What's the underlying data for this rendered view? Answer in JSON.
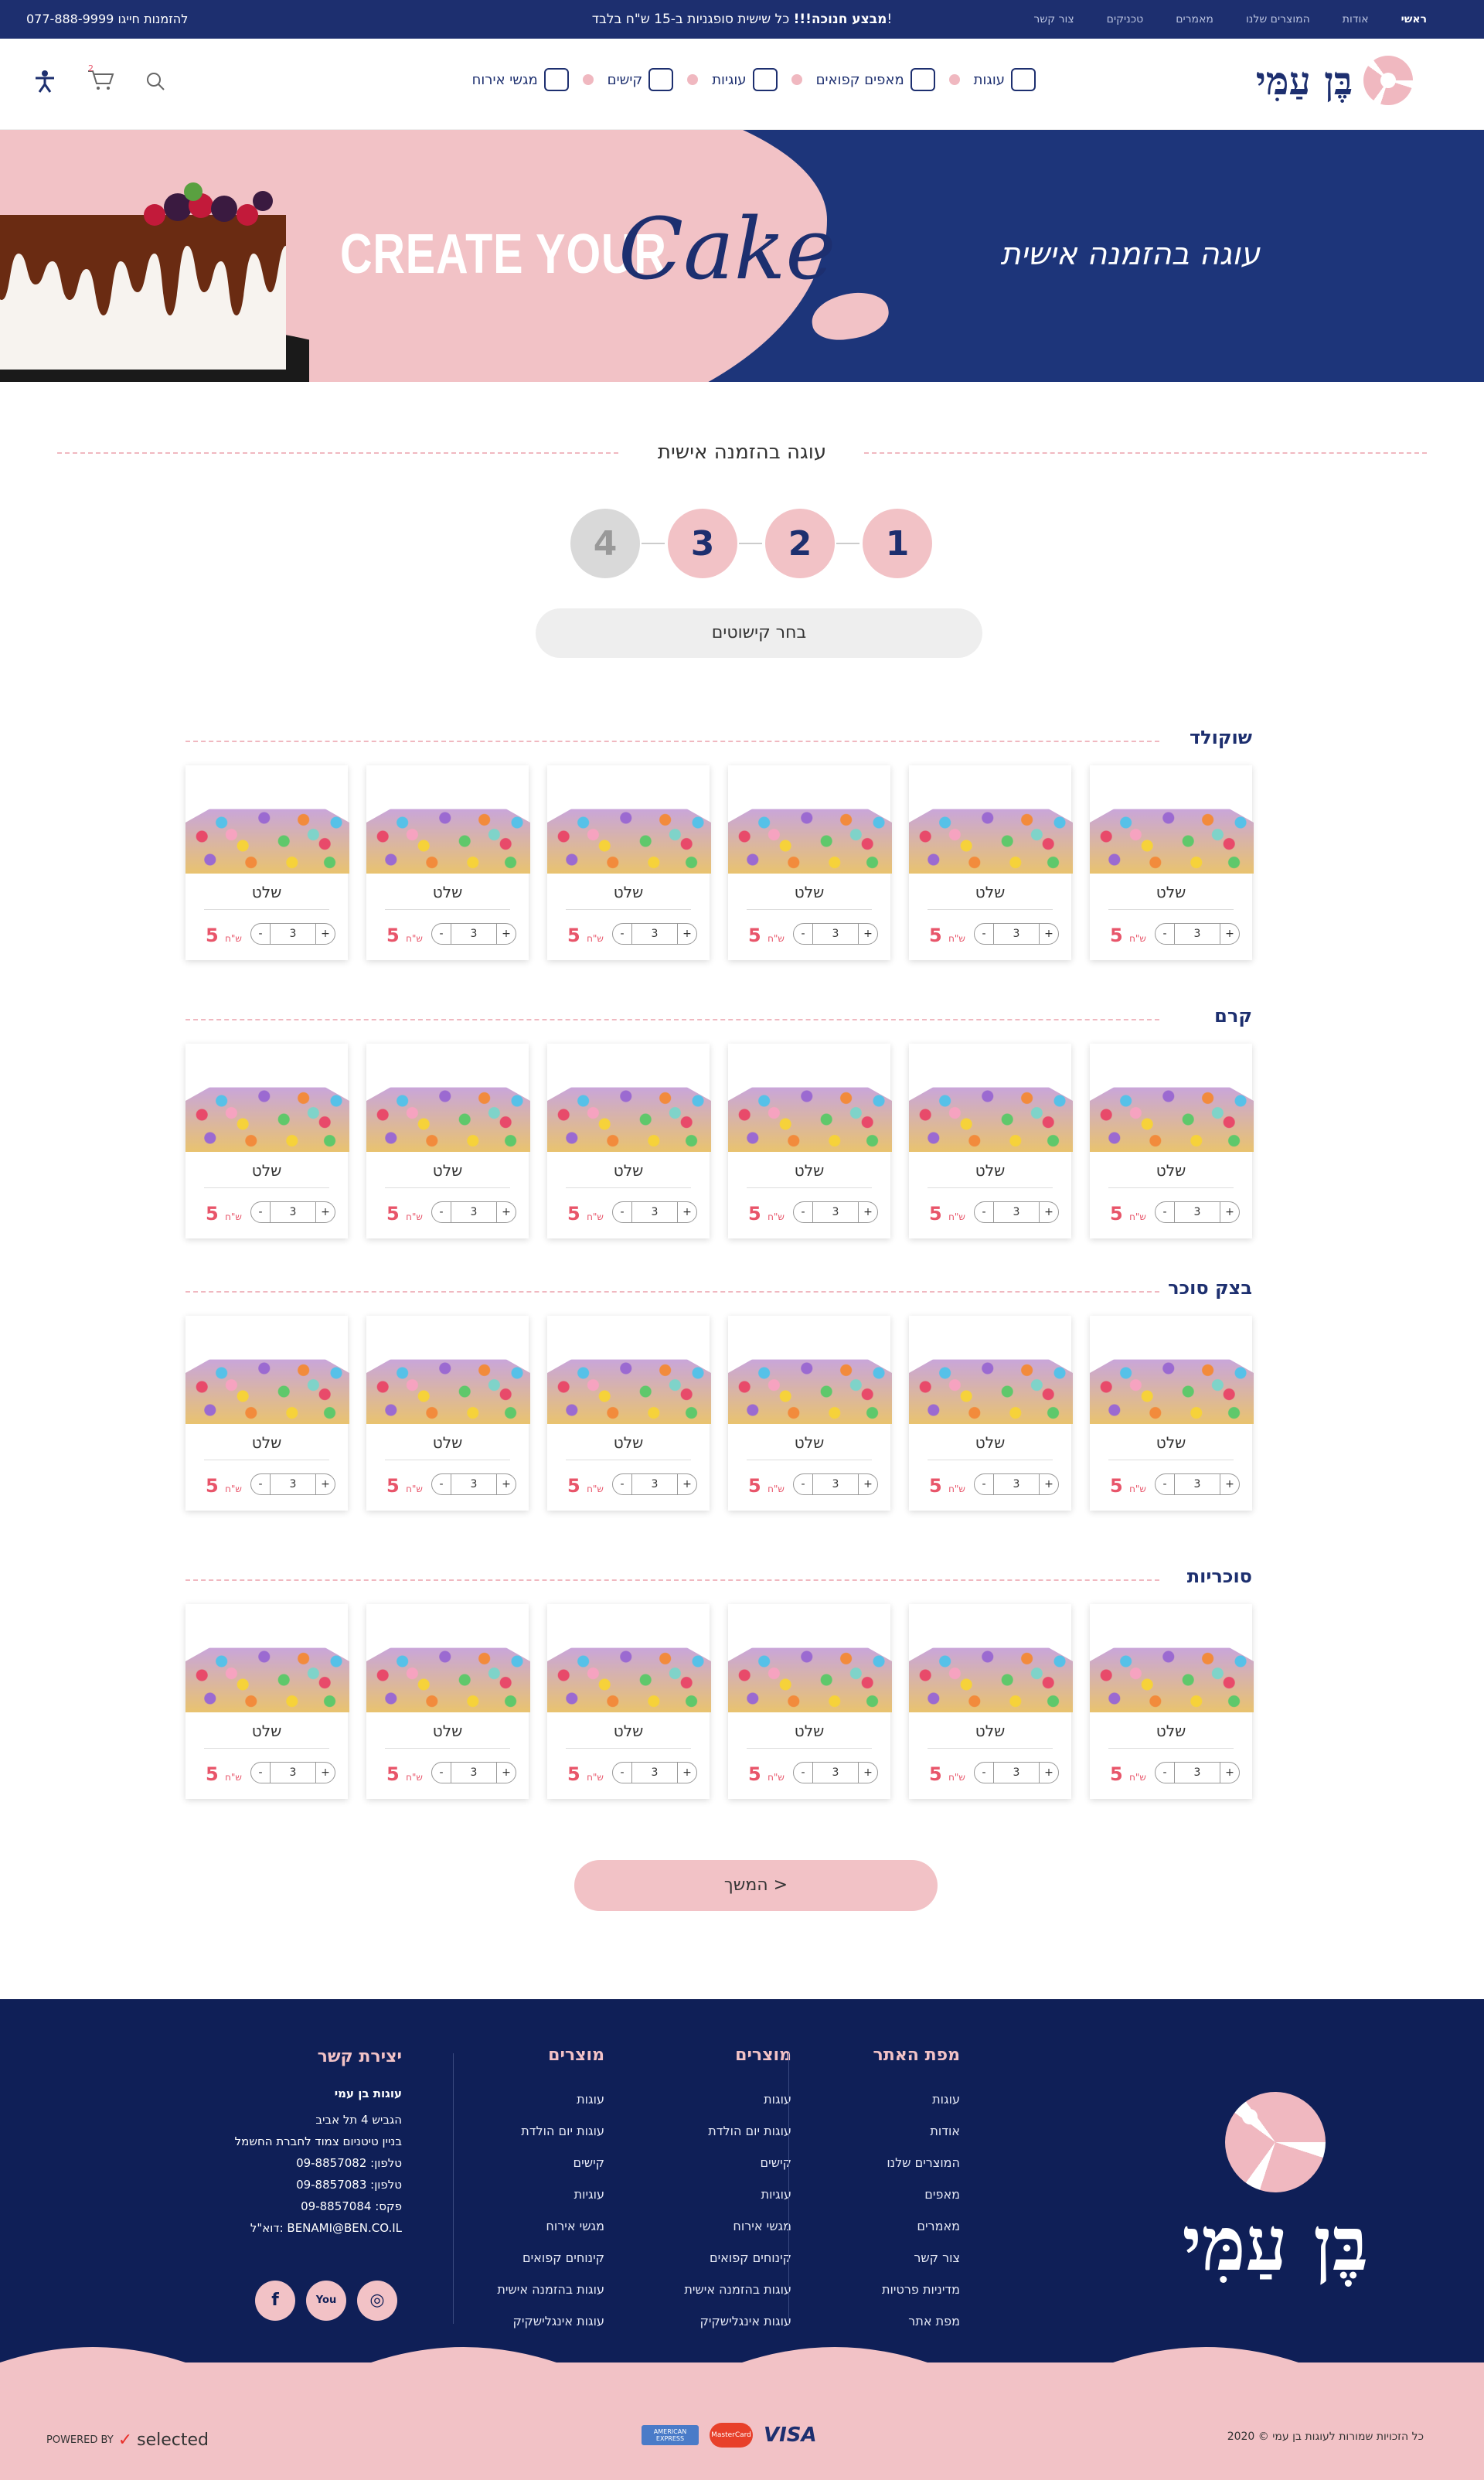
{
  "topbar": {
    "links": [
      "ראשי",
      "אודות",
      "המוצרים שלנו",
      "מאמרים",
      "טכניקים",
      "צור קשר"
    ],
    "promo_bold": "מבצע חנוכה!!!",
    "promo_rest": " כל שישית סופגניות ב-15 ש\"ח בלבד!",
    "phone": "077-888-9999  להזמנות חייגו"
  },
  "header": {
    "logo_text": "בֶּן עַמִּי",
    "nav": [
      "עוגות",
      "מאפים קפואים",
      "עוגיות",
      "קישים",
      "מגשי אירוח"
    ],
    "cart_count": "2"
  },
  "hero": {
    "right_title": "עוגה בהזמנה אישית",
    "create": "CREATE YOUR",
    "cake": "Cake"
  },
  "section": {
    "title": "עוגה בהזמנה אישית",
    "pick_label": "בחר קישוטים",
    "next_label": "המשך >"
  },
  "steps": [
    "1",
    "2",
    "3",
    "4"
  ],
  "categories": [
    {
      "name": "שוקולד",
      "items": [
        {
          "name": "שלט",
          "price": "5",
          "qty": "3"
        },
        {
          "name": "שלט",
          "price": "5",
          "qty": "3"
        },
        {
          "name": "שלט",
          "price": "5",
          "qty": "3"
        },
        {
          "name": "שלט",
          "price": "5",
          "qty": "3"
        },
        {
          "name": "שלט",
          "price": "5",
          "qty": "3"
        },
        {
          "name": "שלט",
          "price": "5",
          "qty": "3"
        }
      ]
    },
    {
      "name": "קרם",
      "items": [
        {
          "name": "שלט",
          "price": "5",
          "qty": "3"
        },
        {
          "name": "שלט",
          "price": "5",
          "qty": "3"
        },
        {
          "name": "שלט",
          "price": "5",
          "qty": "3"
        },
        {
          "name": "שלט",
          "price": "5",
          "qty": "3"
        },
        {
          "name": "שלט",
          "price": "5",
          "qty": "3"
        },
        {
          "name": "שלט",
          "price": "5",
          "qty": "3"
        }
      ]
    },
    {
      "name": "בצק סוכר",
      "items": [
        {
          "name": "שלט",
          "price": "5",
          "qty": "3"
        },
        {
          "name": "שלט",
          "price": "5",
          "qty": "3"
        },
        {
          "name": "שלט",
          "price": "5",
          "qty": "3"
        },
        {
          "name": "שלט",
          "price": "5",
          "qty": "3"
        },
        {
          "name": "שלט",
          "price": "5",
          "qty": "3"
        },
        {
          "name": "שלט",
          "price": "5",
          "qty": "3"
        }
      ]
    },
    {
      "name": "סוכריות",
      "items": [
        {
          "name": "שלט",
          "price": "5",
          "qty": "3"
        },
        {
          "name": "שלט",
          "price": "5",
          "qty": "3"
        },
        {
          "name": "שלט",
          "price": "5",
          "qty": "3"
        },
        {
          "name": "שלט",
          "price": "5",
          "qty": "3"
        },
        {
          "name": "שלט",
          "price": "5",
          "qty": "3"
        },
        {
          "name": "שלט",
          "price": "5",
          "qty": "3"
        }
      ]
    }
  ],
  "currency": "ש\"ח",
  "footer": {
    "logo_text": "בֶּן עַמִּי",
    "sitemap": {
      "title": "מפת האתר",
      "items": [
        "עוגות",
        "אודות",
        "המוצרים שלנו",
        "מאפים",
        "מאמרים",
        "צור קשר",
        "מדיניות פרטיות",
        "מפת אתר"
      ]
    },
    "products1": {
      "title": "מוצרים",
      "items": [
        "עוגות",
        "עוגות יום הולדת",
        "קישים",
        "עוגיות",
        "מגשי אירוח",
        "קינוחים קפואים",
        "עוגות בהזמנה אישית",
        "עוגות אינגלישקיק"
      ]
    },
    "products2": {
      "title": "מוצרים",
      "items": [
        "עוגות",
        "עוגות יום הולדת",
        "קישים",
        "עוגיות",
        "מגשי אירוח",
        "קינוחים קפואים",
        "עוגות בהזמנה אישית",
        "עוגות אינגלישקיק"
      ]
    },
    "contact": {
      "title": "יצירת קשר",
      "company": "עוגות בן עמי",
      "lines": [
        "הגביש 4 תל אביב",
        "בניין טיטניום צמוד לחברת החשמל",
        "טלפון: 09-8857082",
        "טלפון: 09-8857083",
        "פקס: 09-8857084",
        "דוא\"ל: BENAMI@BEN.CO.IL"
      ]
    },
    "social": [
      "f",
      "You",
      "◎"
    ],
    "copyright": "כל הזכויות שמורות לעוגות בן עמי © 2020",
    "powered_by": "POWERED BY",
    "powered_brand": "selected",
    "payments": [
      "AMERICAN EXPRESS",
      "MasterCard",
      "VISA"
    ]
  }
}
